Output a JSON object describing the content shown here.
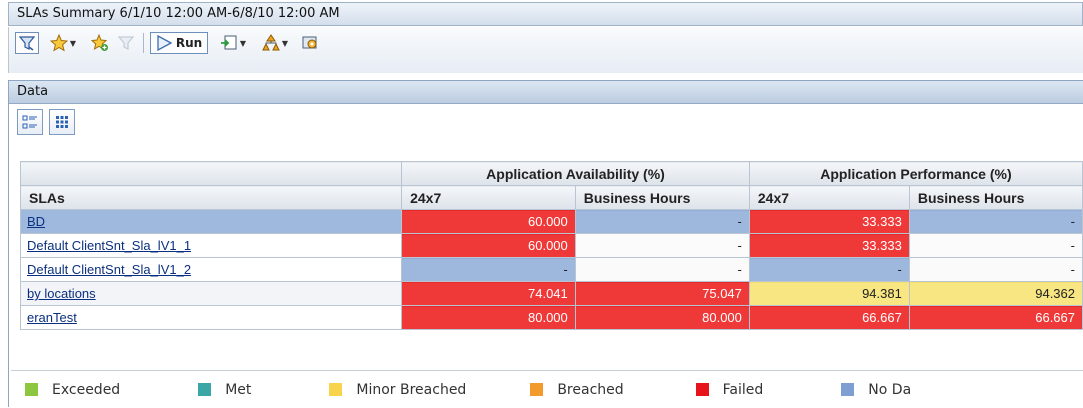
{
  "window": {
    "title": "SLAs Summary 6/1/10 12:00 AM-6/8/10 12:00 AM"
  },
  "toolbar": {
    "run_label": "Run"
  },
  "panel": {
    "title": "Data"
  },
  "table": {
    "group_headers": [
      "Application Availability (%)",
      "Application Performance (%)"
    ],
    "sub_headers": [
      "SLAs",
      "24x7",
      "Business Hours",
      "24x7",
      "Business Hours"
    ],
    "rows": [
      {
        "name": "BD",
        "values": [
          "60.000",
          "-",
          "33.333",
          "-"
        ],
        "statuses": [
          "failed",
          "nodata",
          "failed",
          "nodata"
        ]
      },
      {
        "name": "Default ClientSnt_Sla_lV1_1",
        "values": [
          "60.000",
          "-",
          "33.333",
          "-"
        ],
        "statuses": [
          "failed",
          "none",
          "failed",
          "none"
        ]
      },
      {
        "name": "Default ClientSnt_Sla_lV1_2",
        "values": [
          "-",
          "-",
          "-",
          "-"
        ],
        "statuses": [
          "nodata",
          "none",
          "nodata",
          "none"
        ]
      },
      {
        "name": "by locations",
        "values": [
          "74.041",
          "75.047",
          "94.381",
          "94.362"
        ],
        "statuses": [
          "failed",
          "failed",
          "minor",
          "minor"
        ]
      },
      {
        "name": "eranTest",
        "values": [
          "80.000",
          "80.000",
          "66.667",
          "66.667"
        ],
        "statuses": [
          "failed",
          "failed",
          "failed",
          "failed"
        ]
      }
    ]
  },
  "legend": [
    {
      "label": "Exceeded",
      "color": "#8dc63f"
    },
    {
      "label": "Met",
      "color": "#3aa6a6"
    },
    {
      "label": "Minor Breached",
      "color": "#f7d44c"
    },
    {
      "label": "Breached",
      "color": "#f29b2c"
    },
    {
      "label": "Failed",
      "color": "#e8141b"
    },
    {
      "label": "No Da",
      "color": "#7f9fd3"
    }
  ],
  "icons": [
    "filter-icon",
    "favorites-icon",
    "add-favorite-icon",
    "clear-filter-icon",
    "run-icon",
    "export-icon",
    "hierarchy-icon",
    "settings-icon",
    "list-view-icon",
    "grid-view-icon"
  ]
}
